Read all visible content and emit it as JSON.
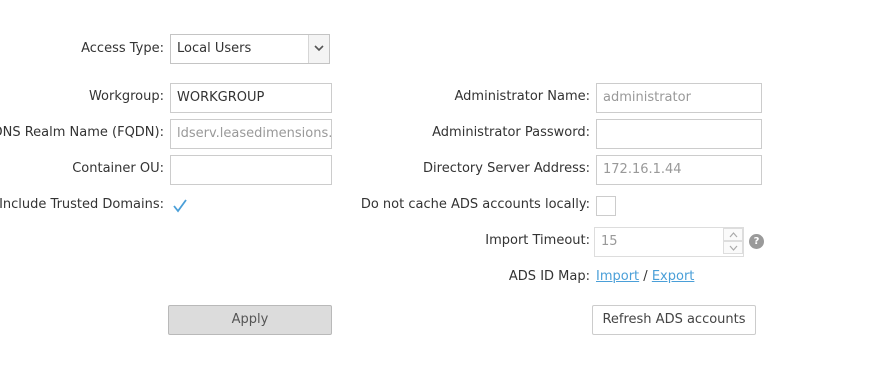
{
  "access_type": {
    "label": "Access Type:",
    "value": "Local Users"
  },
  "workgroup": {
    "label": "Workgroup:",
    "value": "WORKGROUP"
  },
  "dns_realm": {
    "label": "DNS Realm Name (FQDN):",
    "value": "ldserv.leasedimensions.c"
  },
  "container_ou": {
    "label": "Container OU:",
    "value": ""
  },
  "include_trusted_domains": {
    "label": "Include Trusted Domains:",
    "checked": true
  },
  "admin_name": {
    "label": "Administrator Name:",
    "value": "administrator"
  },
  "admin_password": {
    "label": "Administrator Password:",
    "value": ""
  },
  "directory_server": {
    "label": "Directory Server Address:",
    "value": "172.16.1.44"
  },
  "no_cache": {
    "label": "Do not cache ADS accounts locally:",
    "checked": false
  },
  "import_timeout": {
    "label": "Import Timeout:",
    "value": "15"
  },
  "ads_id_map": {
    "label": "ADS ID Map:",
    "import_label": "Import",
    "separator": "/",
    "export_label": "Export"
  },
  "help_glyph": "?",
  "buttons": {
    "apply": "Apply",
    "refresh": "Refresh ADS accounts"
  },
  "colors": {
    "link": "#4a9fd8",
    "check": "#4a9fd8",
    "apply_bg": "#dcdcdc"
  }
}
